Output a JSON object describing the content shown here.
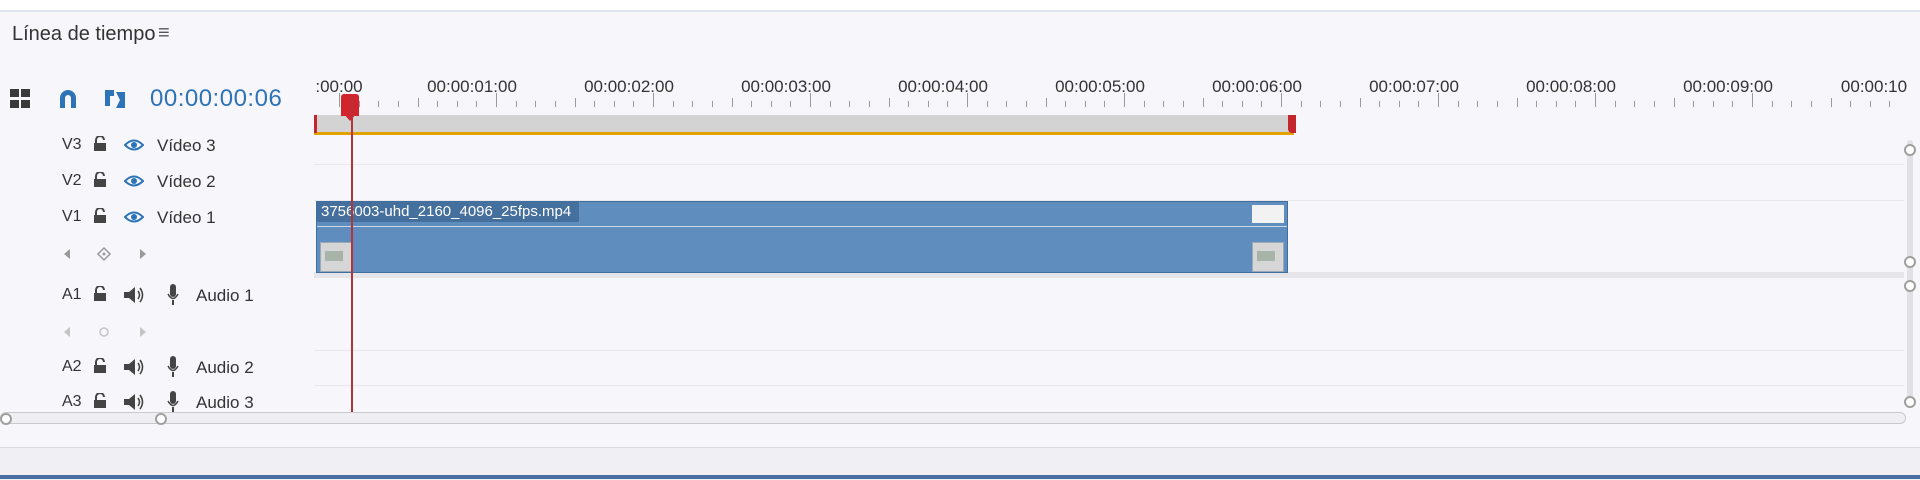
{
  "panel": {
    "title": "Línea de tiempo",
    "menu_glyph": "≡"
  },
  "toolbar": {
    "timecode": "00:00:00:06"
  },
  "ruler": {
    "labels": [
      ":00:00",
      "00:00:01:00",
      "00:00:02:00",
      "00:00:03:00",
      "00:00:04:00",
      "00:00:05:00",
      "00:00:06:00",
      "00:00:07:00",
      "00:00:08:00",
      "00:00:09:00",
      "00:00:10"
    ]
  },
  "tracks": {
    "v3": {
      "id": "V3",
      "name": "Vídeo 3"
    },
    "v2": {
      "id": "V2",
      "name": "Vídeo 2"
    },
    "v1": {
      "id": "V1",
      "name": "Vídeo 1"
    },
    "a1": {
      "id": "A1",
      "name": "Audio 1"
    },
    "a2": {
      "id": "A2",
      "name": "Audio 2"
    },
    "a3": {
      "id": "A3",
      "name": "Audio 3"
    }
  },
  "clip": {
    "filename": "3756003-uhd_2160_4096_25fps.mp4"
  },
  "colors": {
    "accent": "#2d73b8",
    "playhead": "#d1242c",
    "clip": "#5f8dbd",
    "workbar_line": "#e2a300"
  },
  "icons": [
    "hamburger-menu-icon",
    "nest-sequence-icon",
    "snap-magnet-icon",
    "linked-selection-icon",
    "lock-icon",
    "eye-icon",
    "speaker-icon",
    "microphone-icon",
    "keyframe-prev-icon",
    "keyframe-add-icon",
    "keyframe-next-icon"
  ]
}
